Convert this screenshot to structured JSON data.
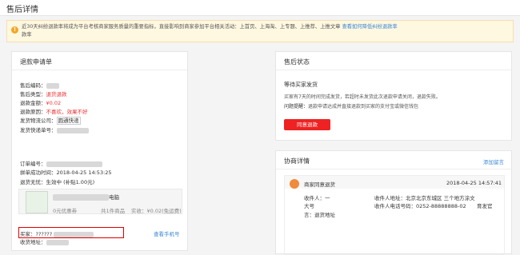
{
  "header": {
    "title": "售后详情"
  },
  "notice": {
    "text": "近30天纠纷退款率将成为平台考核商家服务质量的重要指标，直接影响到商家参加平台相关活动：上首页、上海淘、上专题、上推荐、上推文章",
    "link": "查看如何降低纠纷退款率"
  },
  "refund": {
    "title": "退款申请单",
    "rows": [
      {
        "label": "售后编码：",
        "value": ""
      },
      {
        "label": "售后类型：",
        "value": "退货退款"
      },
      {
        "label": "退款金额：",
        "value": "¥0.02"
      },
      {
        "label": "退款原因：",
        "value": "不喜欢，效果不好"
      },
      {
        "label": "发货物流公司：",
        "value": "圆通快递"
      },
      {
        "label": "发货快递单号：",
        "value": ""
      }
    ],
    "order_label": "订单编号：",
    "time_label": "拼单成功时间：",
    "time_value": "2018-04-25 14:53:25",
    "pref_label": "退货无忧：",
    "pref_value": "生效中 (补贴1.00元)",
    "product": {
      "name_suffix": "电脑",
      "coupon": "0元优惠券",
      "qty": "共1件商品",
      "paid": "实收：¥0.02(免运费)"
    },
    "buyer_label": "买家：",
    "buyer_value": "??????",
    "view_phone": "查看手机号",
    "addr_label": "收货地址："
  },
  "status": {
    "title": "售后状态",
    "state": "等待买家发货",
    "desc": "买家有7天的时间完成发货，若超时未发货此次退款申请关闭，退款失败。",
    "reminder_label": "问题提醒：",
    "reminder_text": "退款申请达成并直接退款到买家的支付宝或微信钱包",
    "button": "同意退款"
  },
  "negotiation": {
    "title": "协商详情",
    "add_msg": "添加留言",
    "entry_title": "商家同意退货",
    "entry_time": "2018-04-25 14:57:41",
    "receiver_label": "收件人：一",
    "receiver_cont": "大号",
    "address_label": "收件人地址：北京北京东城区 三个地方涂文",
    "address_cont": "育发官",
    "phone_label": "收件人电话号码：",
    "phone_value": "0252-88888888-02",
    "note_label": "言：",
    "note_value": "退货地址"
  }
}
